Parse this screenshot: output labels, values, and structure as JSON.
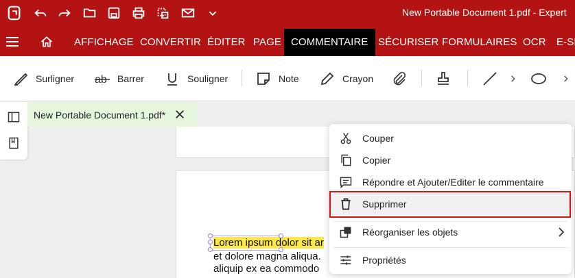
{
  "titlebar": {
    "title": "New Portable Document 1.pdf  -  Expert",
    "accent": "#b31313"
  },
  "menu": {
    "items": [
      "AFFICHAGE",
      "CONVERTIR",
      "ÉDITER",
      "PAGE",
      "COMMENTAIRE",
      "SÉCURISER",
      "FORMULAIRES",
      "OCR",
      "E-SI"
    ],
    "active": "COMMENTAIRE"
  },
  "ribbon": {
    "highlight": "Surligner",
    "strike": "Barrer",
    "underline": "Souligner",
    "note": "Note",
    "pencil": "Crayon"
  },
  "doc_tab": {
    "name": "New Portable Document 1.pdf*"
  },
  "document": {
    "line1_hl": "Lorem ipsum dolor sit ar",
    "line2": "et dolore magna aliqua. ",
    "line3": "aliquip ex ea commodo "
  },
  "context_menu": {
    "cut": "Couper",
    "copy": "Copier",
    "reply": "Répondre et Ajouter/Editer le commentaire",
    "delete": "Supprimer",
    "arrange": "Réorganiser les objets",
    "properties": "Propriétés"
  }
}
